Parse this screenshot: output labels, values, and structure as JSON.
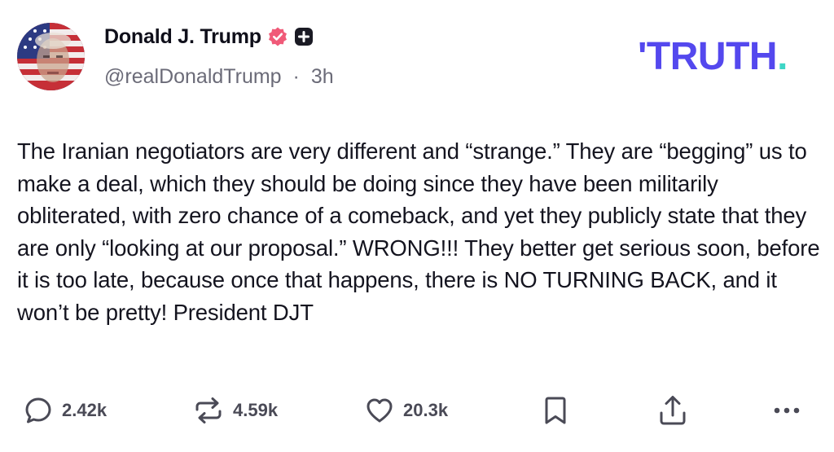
{
  "author": {
    "display_name": "Donald J. Trump",
    "handle": "@realDonaldTrump",
    "separator": "·",
    "time_ago": "3h"
  },
  "brand": {
    "tick": "'",
    "word": "TRUTH",
    "dot": ".",
    "primary_color": "#5448ee",
    "dot_color": "#3ed6c6"
  },
  "badges": {
    "verified_icon": "verified-badge-icon",
    "verified_color": "#f05a78",
    "plus_icon": "plus-square-icon"
  },
  "post": {
    "text": "The Iranian negotiators are very different and “strange.” They are “begging” us to make a deal, which they should be doing since they have been militarily obliterated, with zero chance of a comeback, and yet they publicly state that they are only “looking at our proposal.” WRONG!!! They better get serious soon, before it is too late, because once that happens, there is NO TURNING BACK, and it won’t be pretty! President DJT"
  },
  "actions": {
    "replies": {
      "icon": "reply-icon",
      "count": "2.42k"
    },
    "retruths": {
      "icon": "retruth-icon",
      "count": "4.59k"
    },
    "likes": {
      "icon": "heart-icon",
      "count": "20.3k"
    },
    "bookmark": {
      "icon": "bookmark-icon"
    },
    "share": {
      "icon": "share-icon"
    },
    "more": {
      "icon": "more-options-icon"
    }
  }
}
